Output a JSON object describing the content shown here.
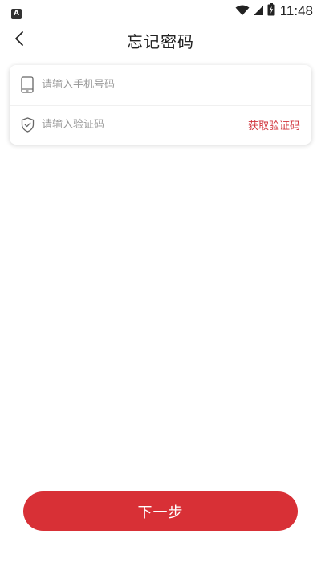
{
  "status_bar": {
    "app_badge": "A",
    "time": "11:48",
    "icons": [
      "wifi-icon",
      "cell-signal-icon",
      "battery-charging-icon"
    ]
  },
  "nav": {
    "title": "忘记密码",
    "back_icon": "chevron-left-icon"
  },
  "form": {
    "phone": {
      "icon": "phone-icon",
      "placeholder": "请输入手机号码",
      "value": ""
    },
    "code": {
      "icon": "shield-check-icon",
      "placeholder": "请输入验证码",
      "value": "",
      "get_code_label": "获取验证码"
    }
  },
  "next_button_label": "下一步",
  "colors": {
    "accent": "#d83036",
    "link": "#d0333a",
    "placeholder": "#9a9a9a",
    "background": "#ffffff"
  }
}
